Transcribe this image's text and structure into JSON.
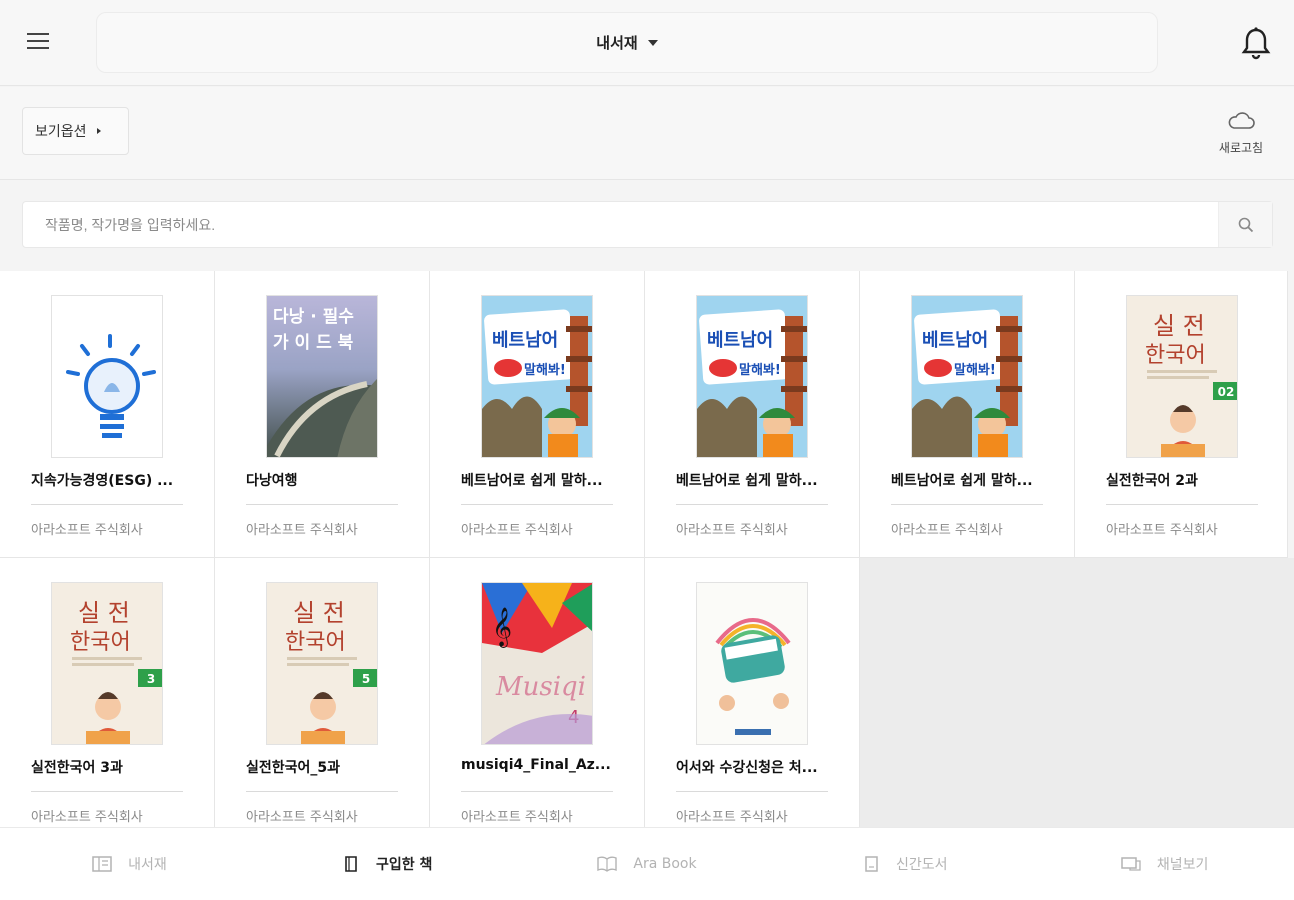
{
  "header": {
    "title": "내서재"
  },
  "toolbar": {
    "view_options_label": "보기옵션",
    "refresh_label": "새로고침"
  },
  "search": {
    "placeholder": "작품명, 작가명을 입력하세요."
  },
  "books": [
    {
      "title": "지속가능경영(ESG) ...",
      "publisher": "아라소프트 주식회사",
      "cover": {
        "kind": "bulb",
        "text": ""
      }
    },
    {
      "title": "다낭여행",
      "publisher": "아라소프트 주식회사",
      "cover": {
        "kind": "danang",
        "text": "다낭 · 필수 가 이 드 북"
      }
    },
    {
      "title": "베트남어로 쉽게 말하...",
      "publisher": "아라소프트 주식회사",
      "cover": {
        "kind": "vietnam",
        "text": "베트남어로 말해봐!"
      }
    },
    {
      "title": "베트남어로 쉽게 말하...",
      "publisher": "아라소프트 주식회사",
      "cover": {
        "kind": "vietnam",
        "text": "베트남어로 말해봐!"
      }
    },
    {
      "title": "베트남어로 쉽게 말하...",
      "publisher": "아라소프트 주식회사",
      "cover": {
        "kind": "vietnam",
        "text": "베트남어로 말해봐!"
      }
    },
    {
      "title": "실전한국어 2과",
      "publisher": "아라소프트 주식회사",
      "cover": {
        "kind": "korean",
        "text": "실 전 한국어",
        "badge": "02"
      }
    },
    {
      "title": "실전한국어 3과",
      "publisher": "아라소프트 주식회사",
      "cover": {
        "kind": "korean",
        "text": "실 전 한국어",
        "badge": "3"
      }
    },
    {
      "title": "실전한국어_5과",
      "publisher": "아라소프트 주식회사",
      "cover": {
        "kind": "korean",
        "text": "실 전 한국어",
        "badge": "5"
      }
    },
    {
      "title": "musiqi4_Final_Az...",
      "publisher": "아라소프트 주식회사",
      "cover": {
        "kind": "music",
        "text": "Musiqi"
      }
    },
    {
      "title": "어서와 수강신청은 처...",
      "publisher": "아라소프트 주식회사",
      "cover": {
        "kind": "course",
        "text": ""
      }
    }
  ],
  "bottom_nav": [
    {
      "label": "내서재",
      "icon": "library-icon",
      "active": false
    },
    {
      "label": "구입한 책",
      "icon": "book-icon",
      "active": true
    },
    {
      "label": "Ara Book",
      "icon": "open-book-icon",
      "active": false
    },
    {
      "label": "신간도서",
      "icon": "new-book-icon",
      "active": false
    },
    {
      "label": "채널보기",
      "icon": "channel-icon",
      "active": false
    }
  ],
  "colors": {
    "accent": "#222222",
    "inactive": "#b3b3b3",
    "badge_green": "#2ea04a"
  }
}
